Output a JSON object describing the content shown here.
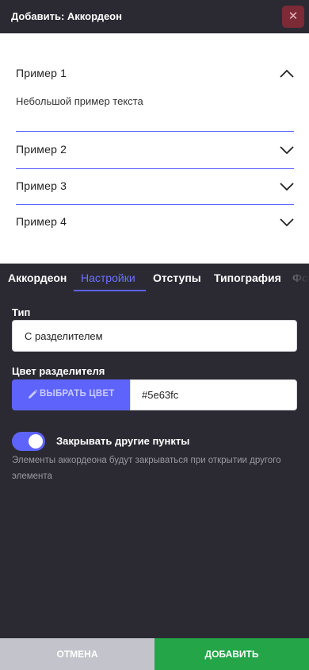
{
  "header": {
    "title": "Добавить: Аккордеон",
    "close_icon": "close-icon"
  },
  "preview": {
    "items": [
      {
        "title": "Пример 1",
        "expanded": true,
        "body": "Небольшой пример текста"
      },
      {
        "title": "Пример 2",
        "expanded": false
      },
      {
        "title": "Пример 3",
        "expanded": false
      },
      {
        "title": "Пример 4",
        "expanded": false
      }
    ]
  },
  "tabs": [
    {
      "label": "Аккордеон",
      "active": false
    },
    {
      "label": "Настройки",
      "active": true
    },
    {
      "label": "Отступы",
      "active": false
    },
    {
      "label": "Типография",
      "active": false
    },
    {
      "label": "Фо",
      "active": false
    }
  ],
  "settings": {
    "type_label": "Тип",
    "type_value": "С разделителем",
    "color_label": "Цвет разделителя",
    "color_button_label": "ВЫБРАТЬ ЦВЕТ",
    "color_value": "#5e63fc",
    "close_others_label": "Закрывать другие пункты",
    "close_others_enabled": true,
    "close_others_hint": "Элементы аккордеона будут закрываться при открытии другого элемента"
  },
  "footer": {
    "cancel_label": "ОТМЕНА",
    "add_label": "ДОБАВИТЬ"
  },
  "colors": {
    "accent": "#5e63fc",
    "add_button": "#23a548",
    "cancel_button": "#c3c4cb",
    "panel_bg": "#2b2a33",
    "close_button": "#7b2a36"
  }
}
